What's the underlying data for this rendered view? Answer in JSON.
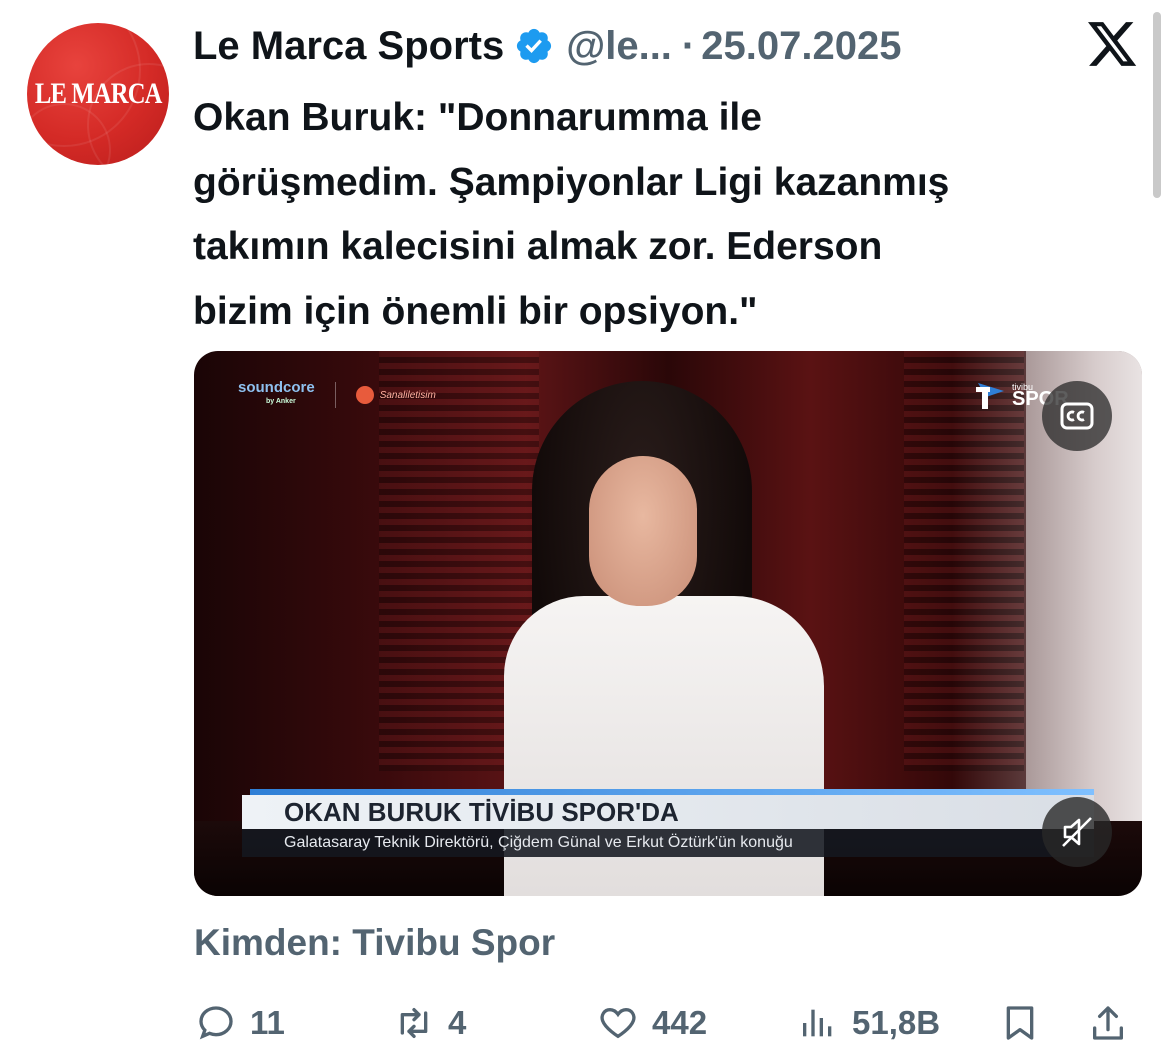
{
  "avatar": {
    "text": "LE MARCA"
  },
  "header": {
    "name": "Le Marca Sports",
    "handle": "@le...",
    "separator": "·",
    "date": "25.07.2025"
  },
  "tweet": {
    "text": "Okan Buruk: \"Donnarumma ile\ngörüşmedim. Şampiyonlar Ligi kazanmış\ntakımın kalecisini almak zor. Ederson\nbizim için önemli bir opsiyon.\""
  },
  "media": {
    "sponsor1": "soundcore",
    "sponsor1_sub": "by Anker",
    "sponsor2": "Sanaliletisim",
    "channel_small": "tivibu",
    "channel": "SPOR",
    "lower_third_title": "OKAN BURUK TİVİBU SPOR'DA",
    "lower_third_subtitle": "Galatasaray Teknik Direktörü, Çiğdem Günal ve Erkut Öztürk'ün konuğu"
  },
  "source": "Kimden: Tivibu Spor",
  "actions": {
    "replies": "11",
    "reposts": "4",
    "likes": "442",
    "views": "51,8B"
  },
  "colors": {
    "accent": "#1d9bf0",
    "muted": "#536471",
    "text": "#0f1419"
  }
}
